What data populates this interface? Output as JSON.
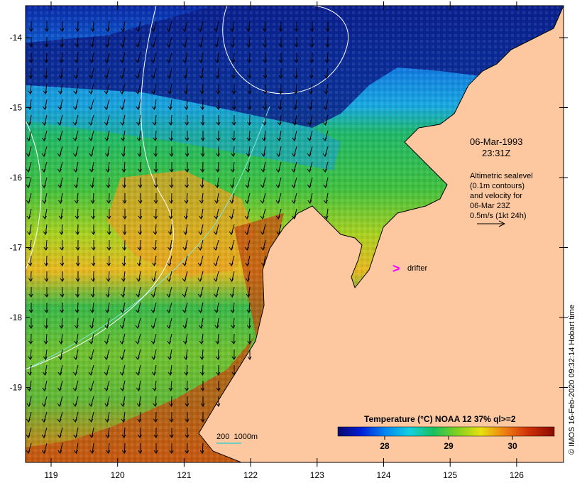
{
  "map": {
    "lat_ticks": [
      "-14",
      "-15",
      "-16",
      "-17",
      "-18",
      "-19"
    ],
    "lon_ticks": [
      "119",
      "120",
      "121",
      "122",
      "123",
      "124",
      "125",
      "126"
    ],
    "datetime_line1": "06-Mar-1993",
    "datetime_line2": "23:31Z",
    "legend_lines": [
      "Altimetric sealevel",
      "(0.1m contours)",
      "and velocity for",
      "06-Mar 23Z",
      "0.5m/s (1kt 24h)"
    ],
    "drifter_label": "drifter",
    "bathy_label": "200  1000m",
    "colorbar": {
      "title": "Temperature (°C) NOAA 12 37% ql>=2",
      "tick_labels": [
        "28",
        "29",
        "30"
      ],
      "colors": [
        "#08086e",
        "#0020d8",
        "#0088f0",
        "#14d0e0",
        "#18c060",
        "#80d020",
        "#e8e010",
        "#f08010",
        "#d03008",
        "#8a0a00"
      ]
    },
    "credit": "© IMOS 16-Feb-2020 09:32:14 Hobart time",
    "colors": {
      "land": "#fdc8a0",
      "drifter": "#ff00ff",
      "bathy_contour": "#80e8e0",
      "sealevel_contour": "#ffffff"
    }
  }
}
